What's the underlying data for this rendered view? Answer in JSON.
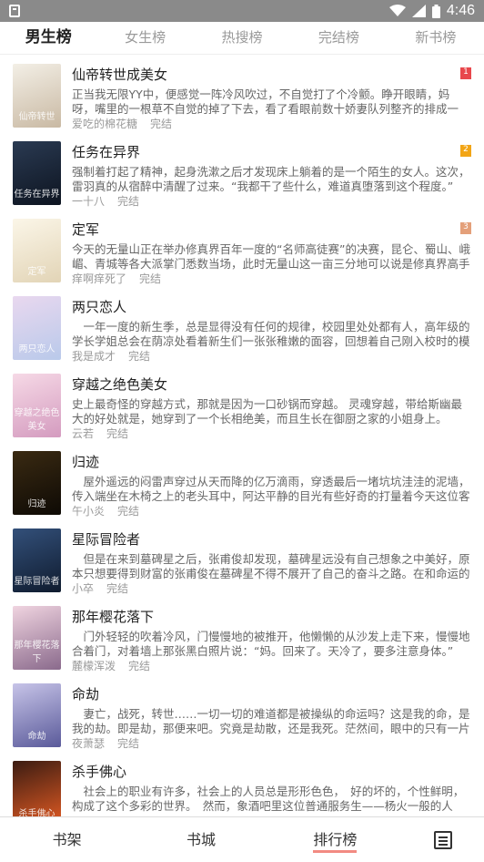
{
  "status": {
    "time": "4:46"
  },
  "tabs": [
    {
      "label": "男生榜",
      "active": true
    },
    {
      "label": "女生榜",
      "active": false
    },
    {
      "label": "热搜榜",
      "active": false
    },
    {
      "label": "完结榜",
      "active": false
    },
    {
      "label": "新书榜",
      "active": false
    }
  ],
  "books": [
    {
      "title": "仙帝转世成美女",
      "desc": "正当我无限YY中，便感觉一阵冷风吹过，不自觉打了个冷颤。睁开眼睛，妈呀，嘴里的一根草不自觉的掉了下去，看了看眼前数十娇妻队列整齐的排成一排。",
      "author": "爱吃的棉花糖",
      "status": "完结",
      "rank": "1",
      "rank_color": "#e8474c",
      "cover_colors": [
        "#f3efe6",
        "#c9b9a3"
      ],
      "cover_text": "仙帝转世"
    },
    {
      "title": "任务在异界",
      "desc": "强制着打起了精神，起身洗漱之后才发现床上躺着的是一个陌生的女人。这次，雷羽真的从宿醉中清醒了过来。“我都干了些什么，难道真堕落到这个程度。”",
      "author": "一十八",
      "status": "完结",
      "rank": "2",
      "rank_color": "#f2a516",
      "cover_colors": [
        "#2a3a52",
        "#0d1420"
      ],
      "cover_text": "任务在异界"
    },
    {
      "title": "定军",
      "desc": "今天的无量山正在举办修真界百年一度的“名师高徒赛”的决赛，昆仑、蜀山、峨嵋、青城等各大派掌门悉数当场，此时无量山这一亩三分地可以说是修真界高手云集。",
      "author": "痒啊痒死了",
      "status": "完结",
      "rank": "3",
      "rank_color": "#e4a07a",
      "cover_colors": [
        "#fbf6e8",
        "#e2d4b6"
      ],
      "cover_text": "定军"
    },
    {
      "title": "两只恋人",
      "desc": "　一年一度的新生季，总是显得没有任何的规律，校园里处处都有人，高年级的学长学姐总会在荫凉处看着新生们一张张稚嫩的面容，回想着自己刚入校时的模样。",
      "author": "我是成才",
      "status": "完结",
      "rank": "",
      "rank_color": "",
      "cover_colors": [
        "#e9d8ef",
        "#b9c9ea"
      ],
      "cover_text": "两只恋人"
    },
    {
      "title": "穿越之绝色美女",
      "desc": "史上最奇怪的穿越方式，那就是因为一口砂锅而穿越。 灵魂穿越，带给斯幽最大的好处就是，她穿到了一个长相绝美，而且生长在御厨之家的小姐身上。",
      "author": "云若",
      "status": "完结",
      "rank": "",
      "rank_color": "",
      "cover_colors": [
        "#f6d9e6",
        "#d49bbf"
      ],
      "cover_text": "穿越之绝色美女"
    },
    {
      "title": "归迹",
      "desc": "　屋外遥远的闷雷声穿过从天而降的亿万滴雨，穿透最后一堵坑坑洼洼的泥墙，传入端坐在木椅之上的老头耳中，阿达平静的目光有些好奇的打量着今天这位客人。",
      "author": "午小炎",
      "status": "完结",
      "rank": "",
      "rank_color": "",
      "cover_colors": [
        "#3a2a12",
        "#0e0a05"
      ],
      "cover_text": "归迹"
    },
    {
      "title": "星际冒险者",
      "desc": "　但是在来到墓碑星之后，张甫俊却发现，墓碑星远没有自己想象之中美好，原本只想要得到财富的张甫俊在墓碑星不得不展开了自己的奋斗之路。在和命运的斗争中成长。",
      "author": "小卒",
      "status": "完结",
      "rank": "",
      "rank_color": "",
      "cover_colors": [
        "#33507a",
        "#0f1b2e"
      ],
      "cover_text": "星际冒险者"
    },
    {
      "title": "那年樱花落下",
      "desc": "　门外轻轻的吹着冷风，门慢慢地的被推开，他懒懒的从沙发上走下来，慢慢地合着门，对着墙上那张黑白照片说：“妈。回来了。天冷了，要多注意身体。”",
      "author": "麓檬浑泼",
      "status": "完结",
      "rank": "",
      "rank_color": "",
      "cover_colors": [
        "#f0d4e0",
        "#8a6a8c"
      ],
      "cover_text": "那年樱花落下"
    },
    {
      "title": "命劫",
      "desc": "　妻亡，战死，转世……一切一切的难道都是被操纵的命运吗？这是我的命，是我的劫。即是劫，那便来吧。究竟是劫散，还是我死。茫然间，眼中的只有一片漆黑。",
      "author": "夜萧瑟",
      "status": "完结",
      "rank": "",
      "rank_color": "",
      "cover_colors": [
        "#c7c4e8",
        "#5a5a9a"
      ],
      "cover_text": "命劫"
    },
    {
      "title": "杀手佛心",
      "desc": "　社会上的职业有许多，社会上的人员总是形形色色，　好的坏的，个性鲜明，构成了这个多彩的世界。　然而，象酒吧里这位普通服务生——杨火一般的人物。",
      "author": "",
      "status": "",
      "rank": "",
      "rank_color": "",
      "cover_colors": [
        "#3b1c12",
        "#e05a23"
      ],
      "cover_text": "杀手佛心"
    }
  ],
  "bottom_nav": [
    {
      "label": "书架",
      "active": false
    },
    {
      "label": "书城",
      "active": false
    },
    {
      "label": "排行榜",
      "active": true
    }
  ],
  "icons": {
    "menu": "menu-icon",
    "wifi": "wifi-icon",
    "signal": "signal-icon",
    "battery": "battery-icon",
    "sd": "sd-card-icon"
  }
}
